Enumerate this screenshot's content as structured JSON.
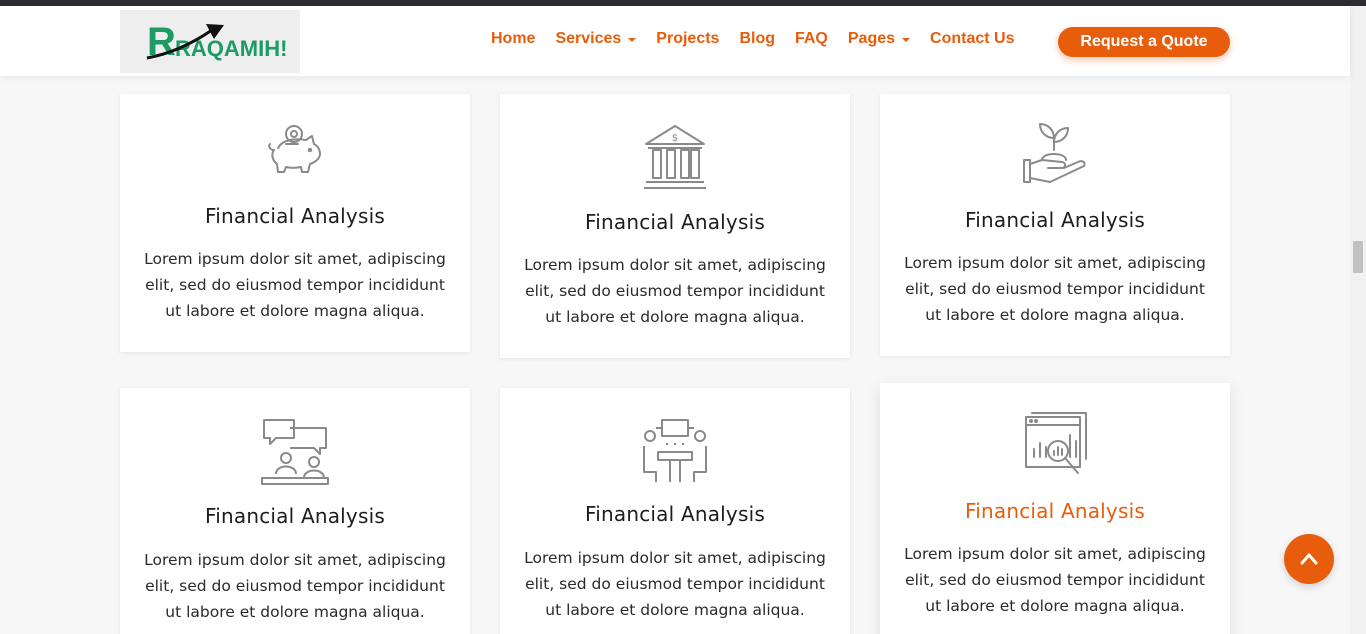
{
  "logo": {
    "alt": "Raqamih logo",
    "text": "RAQAMIH!"
  },
  "nav": {
    "items": [
      {
        "label": "Home",
        "dropdown": false
      },
      {
        "label": "Services",
        "dropdown": true
      },
      {
        "label": "Projects",
        "dropdown": false
      },
      {
        "label": "Blog",
        "dropdown": false
      },
      {
        "label": "FAQ",
        "dropdown": false
      },
      {
        "label": "Pages",
        "dropdown": true
      },
      {
        "label": "Contact Us",
        "dropdown": false
      }
    ],
    "cta_label": "Request a Quote"
  },
  "cards": [
    {
      "icon": "piggy-bank-icon",
      "title": "Financial Analysis",
      "desc": "Lorem ipsum dolor sit amet, adipiscing elit, sed do eiusmod tempor incididunt ut labore et dolore magna aliqua."
    },
    {
      "icon": "bank-icon",
      "title": "Financial Analysis",
      "desc": "Lorem ipsum dolor sit amet, adipiscing elit, sed do eiusmod tempor incididunt ut labore et dolore magna aliqua."
    },
    {
      "icon": "plant-hand-icon",
      "title": "Financial Analysis",
      "desc": "Lorem ipsum dolor sit amet, adipiscing elit, sed do eiusmod tempor incididunt ut labore et dolore magna aliqua."
    },
    {
      "icon": "consultation-icon",
      "title": "Financial Analysis",
      "desc": "Lorem ipsum dolor sit amet, adipiscing elit, sed do eiusmod tempor incididunt ut labore et dolore magna aliqua."
    },
    {
      "icon": "meeting-table-icon",
      "title": "Financial Analysis",
      "desc": "Lorem ipsum dolor sit amet, adipiscing elit, sed do eiusmod tempor incididunt ut labore et dolore magna aliqua."
    },
    {
      "icon": "analytics-search-icon",
      "title": "Financial Analysis",
      "desc": "Lorem ipsum dolor sit amet, adipiscing elit, sed do eiusmod tempor incididunt ut labore et dolore magna aliqua.",
      "active": true
    }
  ],
  "colors": {
    "accent": "#e85d0c",
    "logo_green": "#1e9a64",
    "icon_gray": "#8a8a8a"
  }
}
